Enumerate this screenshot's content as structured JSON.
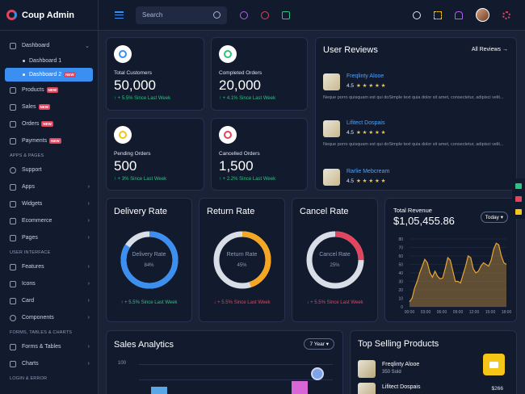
{
  "app": {
    "name": "Coup Admin"
  },
  "sidebar": {
    "dashboard": "Dashboard",
    "dashboard1": "Dashboard 1",
    "dashboard2": "Dashboard 2",
    "new": "NEW",
    "products": "Products",
    "sales": "Sales",
    "orders": "Orders",
    "payments": "Payments",
    "section_apps": "APPS & PAGES",
    "support": "Support",
    "apps": "Apps",
    "widgets": "Widgets",
    "ecommerce": "Ecommerce",
    "pages": "Pages",
    "section_ui": "USER INTERFACE",
    "features": "Features",
    "icons": "Icons",
    "card": "Card",
    "components": "Components",
    "section_forms": "FORMS, TABLES & CHARTS",
    "forms_tables": "Forms & Tables",
    "charts": "Charts",
    "section_login": "LOGIN & ERROR"
  },
  "topbar": {
    "search_placeholder": "Search"
  },
  "stats": [
    {
      "label": "Total Customers",
      "value": "50,000",
      "trend": "↑ + 5.5% Since Last Week",
      "color": "#3b8ff0"
    },
    {
      "label": "Completed Orders",
      "value": "20,000",
      "trend": "↑ + 4.1% Since Last Week",
      "color": "#2ec27e"
    },
    {
      "label": "Pending Orders",
      "value": "500",
      "trend": "↑ + 3% Since Last Week",
      "color": "#f5c518"
    },
    {
      "label": "Cancelled Orders",
      "value": "1,500",
      "trend": "↑ + 2.2% Since Last Week",
      "color": "#e2455e"
    }
  ],
  "reviews": {
    "title": "User Reviews",
    "all_label": "All Reviews →",
    "items": [
      {
        "name": "Freqlinty Alooe",
        "rating": "4.5",
        "stars": "★ ★ ★ ★ ★",
        "text": "Neque porro quisquam est qui doSimple text quia dolor sit amet, consectetur, adipisci velit..."
      },
      {
        "name": "Lifitect Dospais",
        "rating": "4.5",
        "stars": "★ ★ ★ ★ ★",
        "text": "Neque porro quisquam est qui doSimple text quia dolor sit amet, consectetur, adipisci velit..."
      },
      {
        "name": "Rarlie Mebcream",
        "rating": "4.5",
        "stars": "★ ★ ★ ★ ★",
        "text": ""
      }
    ]
  },
  "rates": [
    {
      "title": "Delivery Rate",
      "label": "Delivery Rate",
      "pct_label": "84%",
      "value": 84,
      "color": "#3b8ff0",
      "trend": "↑ + 5.5% Since Last Week",
      "trend_color": "#2ec27e"
    },
    {
      "title": "Return Rate",
      "label": "Return Rate",
      "pct_label": "45%",
      "value": 45,
      "color": "#f5a623",
      "trend": "↓ + 5.5% Since Last Week",
      "trend_color": "#e2455e"
    },
    {
      "title": "Cancel Rate",
      "label": "Cancel Rate",
      "pct_label": "25%",
      "value": 25,
      "color": "#e2455e",
      "trend": "↓ + 5.5% Since Last Week",
      "trend_color": "#e2455e"
    }
  ],
  "total_revenue": {
    "label": "Total Revenue",
    "value": "$1,05,455.86",
    "period": "Today ▾"
  },
  "chart_data": {
    "type": "area",
    "title": "Total Revenue",
    "x": [
      "00:00",
      "03:00",
      "06:00",
      "09:00",
      "12:00",
      "15:00",
      "18:00"
    ],
    "y_ticks": [
      "80",
      "70",
      "60",
      "50",
      "40",
      "30",
      "20",
      "10",
      "0"
    ],
    "ylim": [
      0,
      80
    ],
    "series": [
      {
        "points": [
          [
            0,
            6
          ],
          [
            1,
            10
          ],
          [
            2,
            22
          ],
          [
            3,
            30
          ],
          [
            4,
            40
          ],
          [
            5,
            48
          ],
          [
            6,
            56
          ],
          [
            7,
            52
          ],
          [
            8,
            40
          ],
          [
            9,
            35
          ],
          [
            10,
            42
          ],
          [
            11,
            36
          ],
          [
            12,
            33
          ],
          [
            13,
            34
          ],
          [
            14,
            45
          ],
          [
            15,
            58
          ],
          [
            16,
            55
          ],
          [
            17,
            42
          ],
          [
            18,
            30
          ],
          [
            19,
            30
          ],
          [
            20,
            28
          ],
          [
            21,
            38
          ],
          [
            22,
            48
          ],
          [
            23,
            60
          ],
          [
            24,
            58
          ],
          [
            25,
            45
          ],
          [
            26,
            40
          ],
          [
            27,
            42
          ],
          [
            28,
            48
          ],
          [
            29,
            52
          ],
          [
            30,
            50
          ],
          [
            31,
            48
          ],
          [
            32,
            55
          ],
          [
            33,
            68
          ],
          [
            34,
            75
          ],
          [
            35,
            73
          ],
          [
            36,
            60
          ],
          [
            37,
            52
          ],
          [
            38,
            50
          ]
        ]
      }
    ],
    "color": "#e8a632"
  },
  "sales_analytics": {
    "title": "Sales Analytics",
    "period": "7 Year ▾",
    "axis_top": "100"
  },
  "top_selling": {
    "title": "Top Selling Products",
    "items": [
      {
        "name": "Freqlinty Alooe",
        "sub": "350 Sold",
        "price": ""
      },
      {
        "name": "Lifitect Dospais",
        "sub": "",
        "price": "$266"
      }
    ]
  }
}
